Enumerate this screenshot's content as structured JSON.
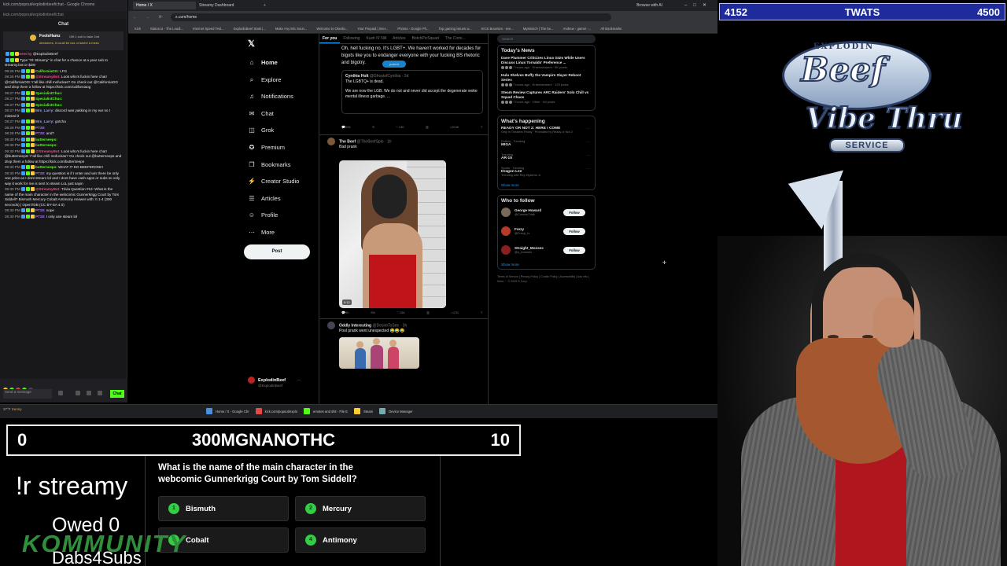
{
  "chat": {
    "popout_title": "kick.com/popout/explodinbeef/chat - Google Chrome",
    "popout_url": "kick.com/popout/explodinbeef/chat",
    "header": "Chat",
    "pinned": {
      "name": "FoolsHamz",
      "sub": "Gift 1 sub to take 2nd",
      "warn": "streamers, it could be lulz or lukee/ a mess"
    },
    "messages": [
      {
        "time": "",
        "user": "Sent by",
        "text": "@ExplodinBeef",
        "color": "#e84a8a"
      },
      {
        "time": "",
        "user": "",
        "text": "Type \"!R Streamy\" in chat for a chance at a year sub to streamy.bot or $25!",
        "color": "#ffffff"
      },
      {
        "time": "09:26 PM",
        "user": "CaliforniaOG:",
        "text": "LFG",
        "color": "#53fc18"
      },
      {
        "time": "09:26 PM",
        "user": "@StreamyBot:",
        "text": "Look who's fuckin here chat! @CaliforniaOG! Y'all like chill mofuckas? Go check out @CaliforniaOG and drop them a follow at https://kick.com/californiaog",
        "color": "#e84a8a"
      },
      {
        "time": "09:27 PM",
        "user": "SpecialistChuc:",
        "text": "",
        "color": "#53fc18"
      },
      {
        "time": "09:27 PM",
        "user": "SpecialistChuc:",
        "text": "",
        "color": "#53fc18"
      },
      {
        "time": "09:27 PM",
        "user": "SpecialistChuc:",
        "text": "",
        "color": "#53fc18"
      },
      {
        "time": "09:27 PM",
        "user": "Mrs_Larry:",
        "text": "discord was yakking in my ear so I missed it",
        "color": "#8fa3ff"
      },
      {
        "time": "09:27 PM",
        "user": "Mrs_Larry:",
        "text": "gotcha",
        "color": "#8fa3ff"
      },
      {
        "time": "09:28 PM",
        "user": "PT28:",
        "text": "",
        "color": "#a86bff"
      },
      {
        "time": "09:28 PM",
        "user": "PT28:",
        "text": "and?",
        "color": "#a86bff"
      },
      {
        "time": "09:30 PM",
        "user": "butterneeps:",
        "text": "",
        "color": "#53fc18"
      },
      {
        "time": "09:30 PM",
        "user": "butterneeps:",
        "text": "",
        "color": "#53fc18"
      },
      {
        "time": "09:30 PM",
        "user": "@StreamyBot:",
        "text": "Look who's fuckin here chat! @butterneeps! Y'all like chill mofuckas? Go check out @butterneeps and drop them a follow at https://kick.com/butterneeps",
        "color": "#e84a8a"
      },
      {
        "time": "09:30 PM",
        "user": "butterneeps:",
        "text": "WHAT IT DO BEEFERONI!!",
        "color": "#53fc18"
      },
      {
        "time": "09:30 PM",
        "user": "PT28:",
        "text": "my question is if I enter and win there be only one prize as I dont stream lol and I dont have cash apps or subs so only way it work for me is sent to steam LoL just sayin",
        "color": "#a86bff"
      },
      {
        "time": "09:30 PM",
        "user": "@StreamyBot:",
        "text": "Trivia Question #13: What is the name of the main character in the webcomic Gunnerkrigg Court by Tom Siddell? Bismuth Mercury Cobalt Antimony Answer with: !t 1-4 (300 seconds) | OpenTDB (CC BY-SA 4.0)",
        "color": "#e84a8a"
      },
      {
        "time": "09:30 PM",
        "user": "PT28:",
        "text": "nope",
        "color": "#a86bff"
      },
      {
        "time": "09:30 PM",
        "user": "PT28:",
        "text": "I only use steam lol",
        "color": "#a86bff"
      }
    ],
    "input_placeholder": "Send a message",
    "send_label": "Chat"
  },
  "browser": {
    "tabs": [
      "Home / X",
      "Streamy Dashboard"
    ],
    "url": "x.com/home",
    "bookmarks": [
      "Kick",
      "Status.io - The Leadi...",
      "Internet Speed Test...",
      "ExplodinBeef Stats |...",
      "Make Any Mic Soun...",
      "Welcome to Okedio...",
      "Your Prepaid | Inter...",
      "Photos - Google Ph...",
      "Top gaming issues w...",
      "KICK Bounties - eve...",
      "Mysteinch | The be...",
      "Andrew - gamer -...",
      "All Bookmarks"
    ],
    "header_right": "Browse with AI"
  },
  "x": {
    "nav": [
      {
        "icon": "home-icon",
        "glyph": "⌂",
        "label": "Home"
      },
      {
        "icon": "explore-icon",
        "glyph": "⌕",
        "label": "Explore"
      },
      {
        "icon": "bell-icon",
        "glyph": "♫",
        "label": "Notifications"
      },
      {
        "icon": "chat-icon",
        "glyph": "✉",
        "label": "Chat"
      },
      {
        "icon": "grok-icon",
        "glyph": "◫",
        "label": "Grok"
      },
      {
        "icon": "premium-icon",
        "glyph": "✪",
        "label": "Premium"
      },
      {
        "icon": "bookmark-icon",
        "glyph": "❐",
        "label": "Bookmarks"
      },
      {
        "icon": "creator-icon",
        "glyph": "⚡",
        "label": "Creator Studio"
      },
      {
        "icon": "articles-icon",
        "glyph": "☰",
        "label": "Articles"
      },
      {
        "icon": "profile-icon",
        "glyph": "☺",
        "label": "Profile"
      },
      {
        "icon": "more-icon",
        "glyph": "⋯",
        "label": "More"
      }
    ],
    "post_label": "Post",
    "account": {
      "name": "ExplodinBeef",
      "handle": "@ExplodinBeef"
    },
    "feed_tabs": [
      "For you",
      "Following",
      "Kush N' Nill",
      "Articles",
      "BotchPicSquad",
      "The Comi..."
    ],
    "tweet1": {
      "text": "Oh, hell fucking no. It's LGBT+. We haven't worked for decades for bigots like you to endanger everyone with your fucking BS rhetoric and bigotry.",
      "quote_name": "Cynthia Holt",
      "quote_handle": "@GhostofCynthia · 2d",
      "quote_text1": "The LGBTQ+ is dead.",
      "quote_text2": "We are now the LGB. We do not and never did accept the degenerate woke mental illness garbage. ...",
      "play_label": "posted",
      "stats": [
        "695",
        "",
        "13K",
        "",
        "204K",
        ""
      ]
    },
    "tweet2": {
      "name": "The Beef",
      "handle": "@TheBeefSpin · 1h",
      "text": "Bad prank",
      "duration": "0:12",
      "stats": [
        "90",
        "8",
        "136",
        "",
        "17K",
        ""
      ]
    },
    "tweet3": {
      "name": "Oddly Interesting",
      "handle": "@DesireToSee · 3h",
      "text": "Pool prank went unexpected 😂😂😂"
    },
    "search_placeholder": "Search",
    "news_title": "Today's News",
    "news": [
      {
        "title": "Dave Plummer Criticizes Linux GUIs While Users Discuss Linus Torvalds' Preference ...",
        "meta": "7 hours ago · Entertainment · 5K posts"
      },
      {
        "title": "Hulu Shelves Buffy the Vampire Slayer Reboot Series",
        "meta": "7 hours ago · Entertainment · 129 posts"
      },
      {
        "title": "Steam Review Captures ARC Raiders' Solo Chill vs Squad Chaos",
        "meta": "7 hours ago · Other · 64 posts"
      }
    ],
    "happening_title": "What's happening",
    "trends": [
      {
        "cat": "",
        "name": "READY OR NOT 2: HERE I COME",
        "sub": "Only in Theaters Friday · Promoted by Ready or Not 2"
      },
      {
        "cat": "Politics · Trending",
        "name": "MIGA",
        "sub": ""
      },
      {
        "cat": "Trending",
        "name": "AR-15",
        "sub": ""
      },
      {
        "cat": "Sports · Trending",
        "name": "Dragon Lee",
        "sub": "Trending with Rey Mysterio Jr"
      }
    ],
    "show_more": "Show more",
    "who_title": "Who to follow",
    "who": [
      {
        "name": "George Howard",
        "handle": "@CosmicTusk",
        "color": "#7a6a5a"
      },
      {
        "name": "Frezy",
        "handle": "@Frezy_tv",
        "color": "#b53a2a"
      },
      {
        "name": "Straight_Mosses",
        "handle": "@s_mosses",
        "color": "#8a1f1f"
      }
    ],
    "follow_label": "Follow",
    "footer": "Terms of Service | Privacy Policy | Cookie Policy | Accessibility | Ads info | More ··· © 2025 X Corp."
  },
  "taskbar": {
    "weather": "37°F Sunny",
    "items": [
      "Home / X - Google Chr",
      "kick.com/popout/explo",
      "emotes and shit - File E",
      "Steam",
      "Device Manager"
    ]
  },
  "overlay": {
    "top_left": "4152",
    "top_title": "TWATS",
    "top_right": "4500",
    "bar_left": "0",
    "bar_title": "300MGNANOTHC",
    "bar_right": "10",
    "question": "What is the name of the main character in the webcomic Gunnerkrigg Court by Tom Siddell?",
    "answers": [
      {
        "n": "1",
        "label": "Bismuth"
      },
      {
        "n": "2",
        "label": "Mercury"
      },
      {
        "n": "3",
        "label": "Cobalt"
      },
      {
        "n": "4",
        "label": "Antimony"
      }
    ],
    "streamy": "!r streamy",
    "owed": "Owed 0",
    "kommunity": "KOMMUNITY",
    "dabs": "Dabs4Subs"
  },
  "logo": {
    "top": "EXPLODIN",
    "beef": "Beef",
    "vibe": "Vibe Thru",
    "service": "SERVICE"
  }
}
